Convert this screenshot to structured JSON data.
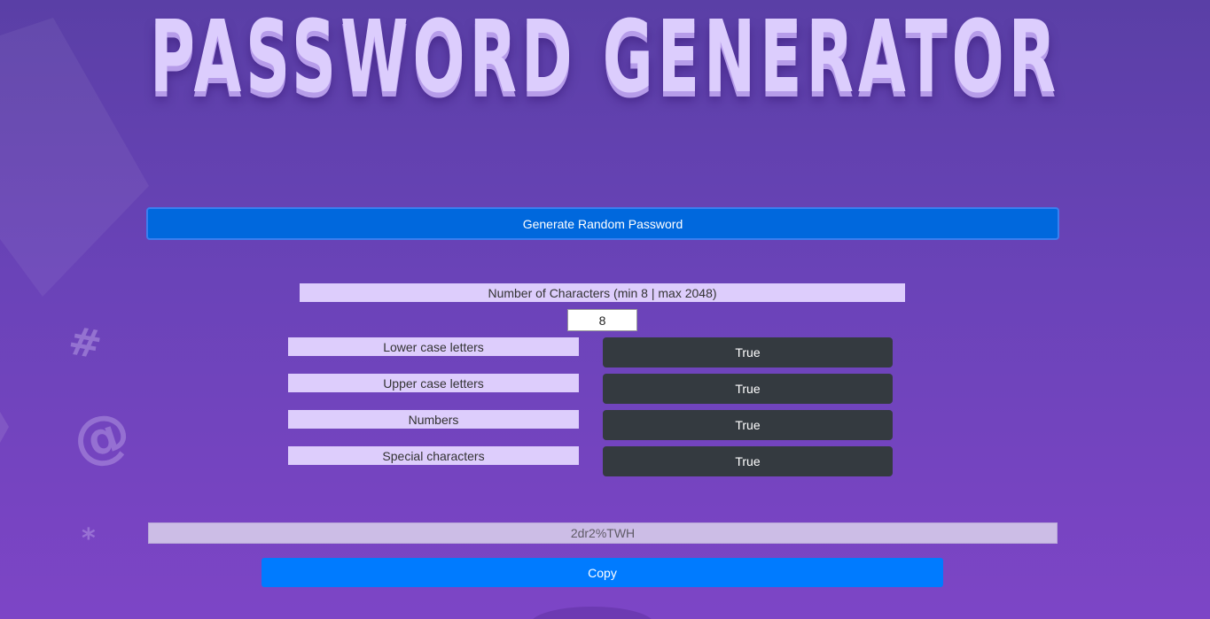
{
  "page": {
    "title": "PASSWORD GENERATOR"
  },
  "actions": {
    "generate_label": "Generate Random Password",
    "copy_label": "Copy"
  },
  "length": {
    "label": "Number of Characters (min 8 | max 2048)",
    "value": "8"
  },
  "options": [
    {
      "label": "Lower case letters",
      "state": "True"
    },
    {
      "label": "Upper case letters",
      "state": "True"
    },
    {
      "label": "Numbers",
      "state": "True"
    },
    {
      "label": "Special characters",
      "state": "True"
    }
  ],
  "output": {
    "value": "2dr2%TWH"
  },
  "decor": {
    "hash_glyph": "#",
    "at_glyph": "@",
    "star_glyph": "*"
  },
  "colors": {
    "background_top": "#5a3fa6",
    "background_bottom": "#7d45c6",
    "title": "#dccdfd",
    "generate_button": "#0068dd",
    "label_background": "#ddcdfc",
    "toggle_button": "#343a40",
    "output_background": "#ccbde6",
    "copy_button": "#007bff"
  }
}
